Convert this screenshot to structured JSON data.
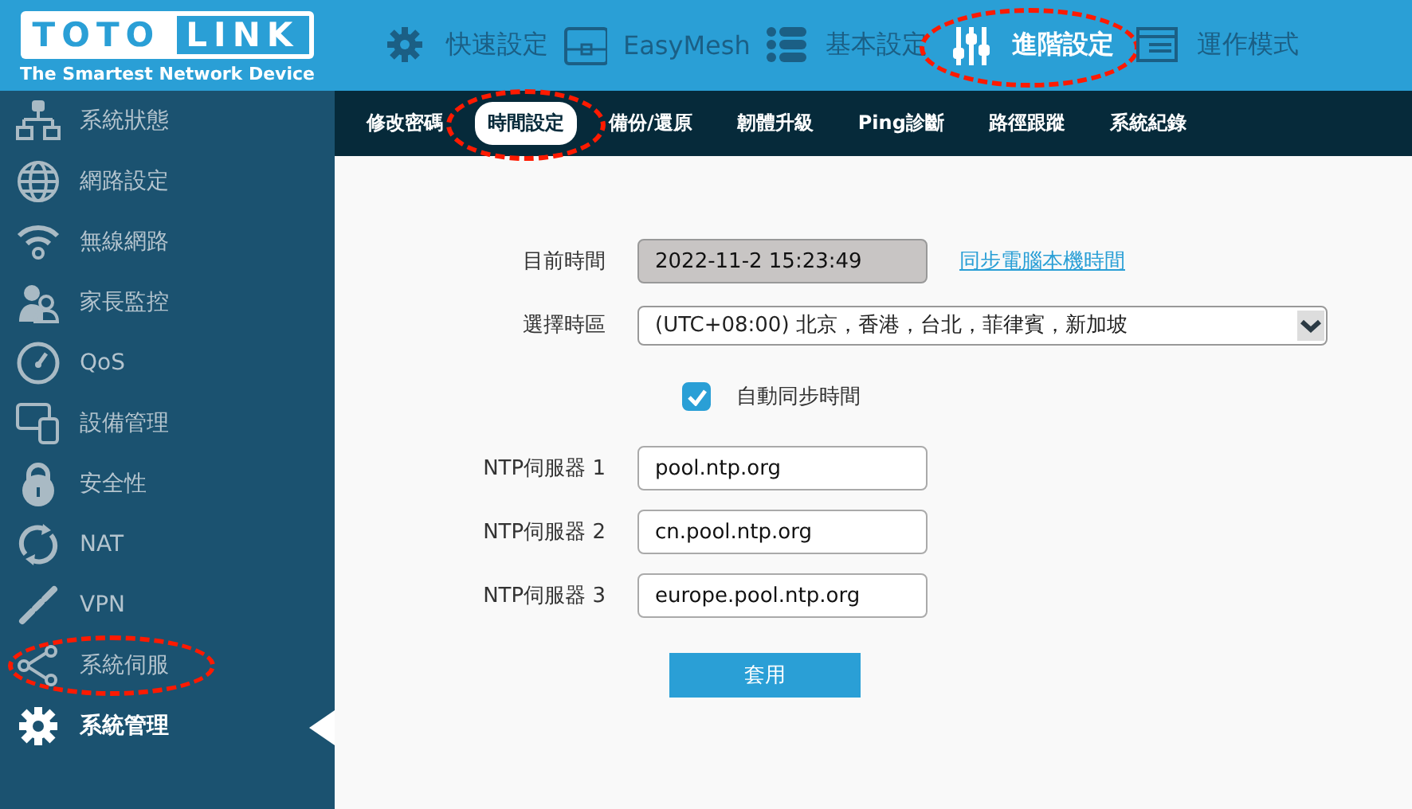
{
  "logo": {
    "left": "TOTO",
    "right": "LINK",
    "tagline": "The Smartest Network Device"
  },
  "top_nav": [
    {
      "label": "快速設定",
      "selected": false,
      "highlighted": false
    },
    {
      "label": "EasyMesh",
      "selected": false,
      "highlighted": false
    },
    {
      "label": "基本設定",
      "selected": false,
      "highlighted": false
    },
    {
      "label": "進階設定",
      "selected": true,
      "highlighted": true
    },
    {
      "label": "運作模式",
      "selected": false,
      "highlighted": false
    }
  ],
  "sidebar": {
    "items": [
      {
        "label": "系統狀態",
        "selected": false,
        "highlighted": false
      },
      {
        "label": "網路設定",
        "selected": false,
        "highlighted": false
      },
      {
        "label": "無線網路",
        "selected": false,
        "highlighted": false
      },
      {
        "label": "家長監控",
        "selected": false,
        "highlighted": false
      },
      {
        "label": "QoS",
        "selected": false,
        "highlighted": false
      },
      {
        "label": "設備管理",
        "selected": false,
        "highlighted": false
      },
      {
        "label": "安全性",
        "selected": false,
        "highlighted": false
      },
      {
        "label": "NAT",
        "selected": false,
        "highlighted": false
      },
      {
        "label": "VPN",
        "selected": false,
        "highlighted": false
      },
      {
        "label": "系統伺服",
        "selected": false,
        "highlighted": true
      },
      {
        "label": "系統管理",
        "selected": true,
        "highlighted": false
      }
    ]
  },
  "sub_tabs": [
    {
      "label": "修改密碼",
      "selected": false,
      "highlighted": false
    },
    {
      "label": "時間設定",
      "selected": true,
      "highlighted": true
    },
    {
      "label": "備份/還原",
      "selected": false,
      "highlighted": false
    },
    {
      "label": "韌體升級",
      "selected": false,
      "highlighted": false
    },
    {
      "label": "Ping診斷",
      "selected": false,
      "highlighted": false
    },
    {
      "label": "路徑跟蹤",
      "selected": false,
      "highlighted": false
    },
    {
      "label": "系統紀錄",
      "selected": false,
      "highlighted": false
    }
  ],
  "form": {
    "current_time": {
      "label": "目前時間",
      "value": "2022-11-2 15:23:49",
      "link": "同步電腦本機時間"
    },
    "timezone": {
      "label": "選擇時區",
      "value": "(UTC+08:00) 北京，香港，台北，菲律賓，新加坡"
    },
    "auto_sync": {
      "label": "自動同步時間",
      "checked": true
    },
    "ntp_servers": [
      {
        "label": "NTP伺服器 1",
        "value": "pool.ntp.org"
      },
      {
        "label": "NTP伺服器 2",
        "value": "cn.pool.ntp.org"
      },
      {
        "label": "NTP伺服器 3",
        "value": "europe.pool.ntp.org"
      }
    ],
    "apply_button": "套用"
  }
}
